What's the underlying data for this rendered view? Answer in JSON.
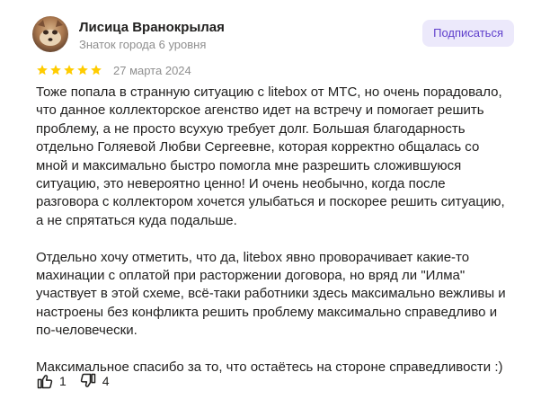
{
  "author": {
    "name": "Лисица Вранокрылая",
    "level": "Знаток города 6 уровня"
  },
  "subscribe_label": "Подписаться",
  "rating": {
    "value": 5,
    "max": 5,
    "color": "#fc0"
  },
  "date": "27 марта 2024",
  "paragraphs": [
    "Тоже попала в странную ситуацию с litebox от МТС, но очень порадовало,\nчто данное коллекторское агенство идет на встречу и помогает решить\nпроблему, а не просто всухую требует долг. Большая благодарность\nотдельно Голяевой Любви Сергеевне, которая корректно общалась со\nмной и максимально быстро помогла мне разрешить сложившуюся\nситуацию, это невероятно ценно! И очень необычно, когда после\nразговора с коллектором хочется улыбаться и поскорее решить ситуацию,\nа не спрятаться куда подальше.",
    "Отдельно хочу отметить, что да, litebox явно проворачивает какие-то\nмахинации с оплатой при расторжении договора, но вряд ли \"Илма\"\nучаствует в этой схеме, всё-таки работники здесь максимально вежливы и\nнастроены без конфликта решить проблему максимально справедливо и\nпо-человечески.",
    "Максимальное спасибо за то, что остаётесь на стороне справедливости :)"
  ],
  "reactions": {
    "like_count": "1",
    "dislike_count": "4"
  }
}
